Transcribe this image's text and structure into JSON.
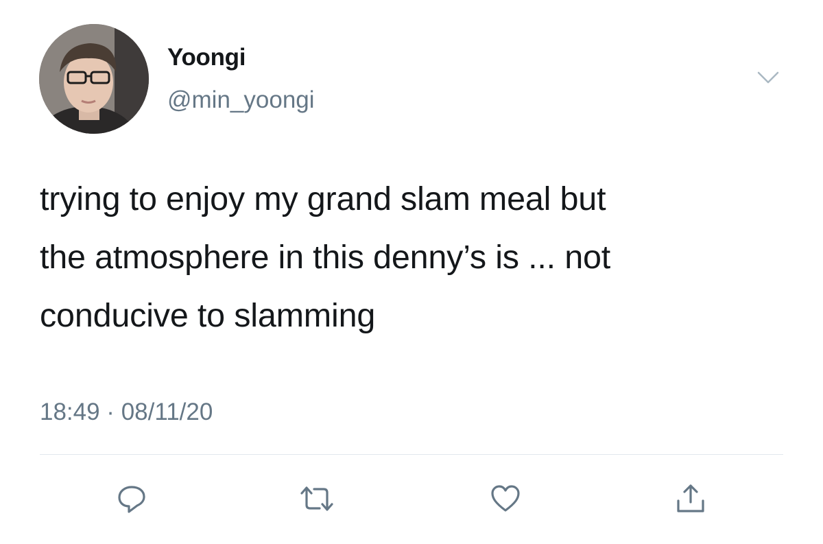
{
  "user": {
    "display_name": "Yoongi",
    "handle": "@min_yoongi"
  },
  "tweet": {
    "lines": [
      "trying to enjoy my grand slam meal but",
      "the atmosphere in this denny’s is ... not",
      "conducive to slamming"
    ],
    "timestamp": "18:49 · 08/11/20"
  },
  "icons": {
    "menu": "chevron-down-icon",
    "reply": "reply-icon",
    "retweet": "retweet-icon",
    "like": "heart-icon",
    "share": "share-icon"
  },
  "colors": {
    "text": "#14171a",
    "secondary": "#657786",
    "icon": "#657786",
    "divider": "#e1e8ed"
  }
}
